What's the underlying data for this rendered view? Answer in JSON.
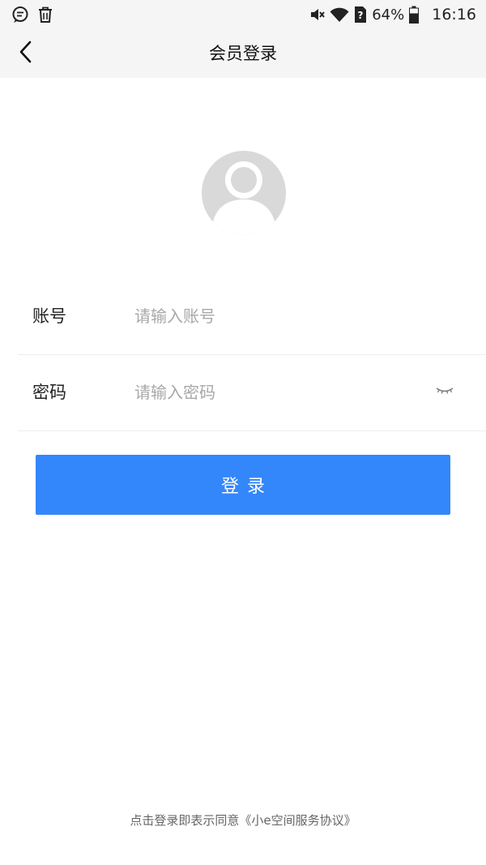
{
  "status_bar": {
    "battery_percent": "64%",
    "time": "16:16",
    "icons": [
      "message-icon",
      "trash-icon",
      "mute-icon",
      "wifi-icon",
      "sim-unknown-icon",
      "battery-icon"
    ]
  },
  "nav": {
    "title": "会员登录",
    "back_icon": "chevron-left-icon"
  },
  "avatar": {
    "icon": "default-avatar-icon"
  },
  "form": {
    "account": {
      "label": "账号",
      "placeholder": "请输入账号",
      "value": ""
    },
    "password": {
      "label": "密码",
      "placeholder": "请输入密码",
      "value": "",
      "toggle_icon": "eye-closed-icon"
    }
  },
  "login_button": {
    "label": "登录"
  },
  "agreement": {
    "prefix": "点击登录即表示同意",
    "link": "《小e空间服务协议》"
  },
  "colors": {
    "primary": "#3487fb",
    "header_bg": "#f5f5f5",
    "placeholder": "#a8a8a8",
    "avatar": "#d9d9d9"
  }
}
